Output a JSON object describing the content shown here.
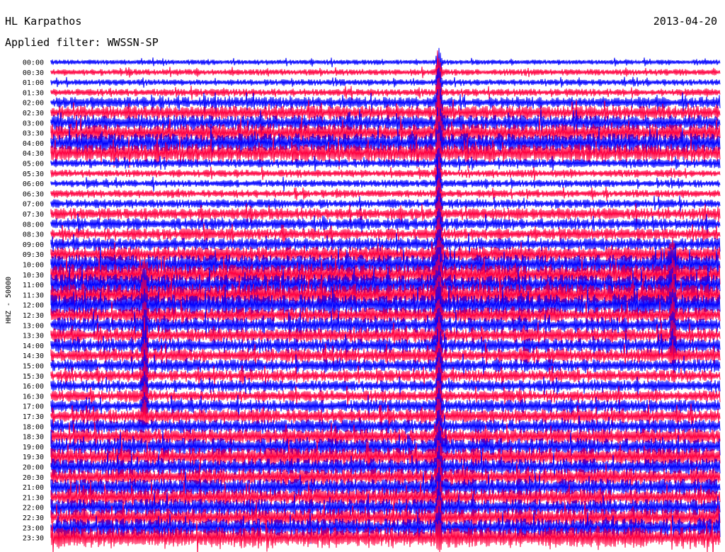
{
  "header": {
    "station": "HL Karpathos",
    "filter": "Applied filter: WWSSN-SP",
    "date": "2013-04-20"
  },
  "chart_data": {
    "type": "line",
    "title": "HL Karpathos",
    "subtitle": "Applied filter: WWSSN-SP",
    "date": "2013-04-20",
    "ylabel": "HHZ - 50000",
    "xlabel": "",
    "trace_labels": [
      "00:00",
      "00:30",
      "01:00",
      "01:30",
      "02:00",
      "02:30",
      "03:00",
      "03:30",
      "04:00",
      "04:30",
      "05:00",
      "05:30",
      "06:00",
      "06:30",
      "07:00",
      "07:30",
      "08:00",
      "08:30",
      "09:00",
      "09:30",
      "10:00",
      "10:30",
      "11:00",
      "11:30",
      "12:00",
      "12:30",
      "13:00",
      "13:30",
      "14:00",
      "14:30",
      "15:00",
      "15:30",
      "16:00",
      "16:30",
      "17:00",
      "17:30",
      "18:00",
      "18:30",
      "19:00",
      "19:30",
      "20:00",
      "20:30",
      "21:00",
      "21:30",
      "22:00",
      "22:30",
      "23:00",
      "23:30"
    ],
    "series_colors": [
      "#0000ff",
      "#ff0040"
    ],
    "trace_amplitude_level": [
      0.2,
      0.25,
      0.25,
      0.3,
      0.45,
      0.55,
      0.6,
      0.7,
      0.75,
      0.7,
      0.35,
      0.3,
      0.3,
      0.3,
      0.35,
      0.45,
      0.45,
      0.45,
      0.5,
      0.6,
      0.75,
      0.8,
      0.8,
      0.85,
      0.8,
      0.6,
      0.6,
      0.55,
      0.55,
      0.55,
      0.5,
      0.45,
      0.45,
      0.45,
      0.5,
      0.55,
      0.55,
      0.6,
      0.65,
      0.7,
      0.65,
      0.65,
      0.65,
      0.65,
      0.65,
      0.7,
      0.7,
      0.8
    ],
    "events": [
      {
        "label": "spike",
        "trace_start": "00:00",
        "trace_end": "23:30",
        "position_fraction": 0.58
      },
      {
        "label": "burst",
        "trace_start": "10:30",
        "trace_end": "17:30",
        "position_fraction": 0.14
      },
      {
        "label": "burst",
        "trace_start": "09:30",
        "trace_end": "14:30",
        "position_fraction": 0.93
      }
    ],
    "grid": false,
    "legend": "none"
  }
}
